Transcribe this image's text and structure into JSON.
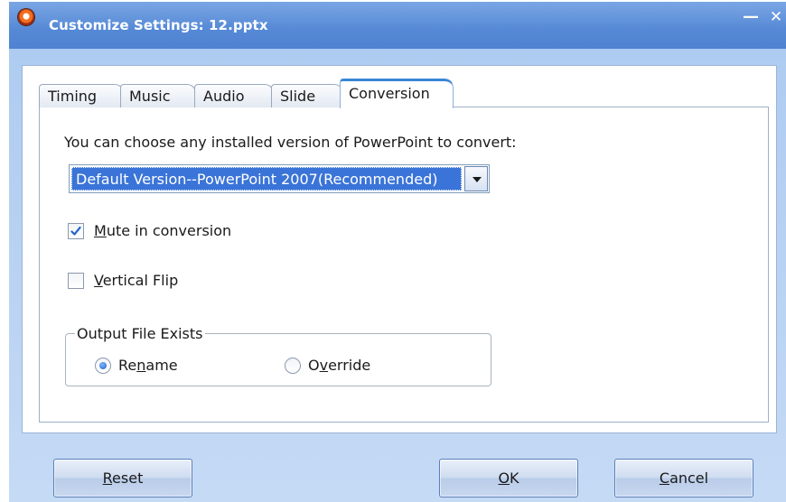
{
  "window": {
    "title": "Customize Settings: 12.pptx",
    "minimize_glyph": "—",
    "close_glyph": "✕"
  },
  "tabs": [
    {
      "label": "Timing",
      "active": false
    },
    {
      "label": "Music",
      "active": false
    },
    {
      "label": "Audio",
      "active": false
    },
    {
      "label": "Slide",
      "active": false
    },
    {
      "label": "Conversion",
      "active": true
    }
  ],
  "conversion": {
    "version_prompt": "You can choose any installed version of PowerPoint to convert:",
    "version_selected": "Default Version--PowerPoint 2007(Recommended)",
    "mute": {
      "label_before": "",
      "label_key": "M",
      "label_after": "ute in conversion",
      "checked": true
    },
    "vertical_flip": {
      "label_before": "",
      "label_key": "V",
      "label_after": "ertical Flip",
      "checked": false
    },
    "output_group": {
      "legend": "Output File Exists",
      "rename": {
        "label_before": "Re",
        "label_key": "n",
        "label_after": "ame",
        "selected": true
      },
      "override": {
        "label_before": "O",
        "label_key": "v",
        "label_after": "erride",
        "selected": false
      }
    }
  },
  "buttons": {
    "reset": {
      "label_before": "",
      "label_key": "R",
      "label_after": "eset"
    },
    "ok": {
      "label_before": "",
      "label_key": "O",
      "label_after": "K"
    },
    "cancel": {
      "label_before": "",
      "label_key": "C",
      "label_after": "ancel"
    }
  },
  "colors": {
    "title_bar": "#5589d6",
    "selection": "#3a74d8",
    "check_mark": "#1f63c9"
  },
  "icons": {
    "app": "app-logo-icon",
    "dropdown": "chevron-down-icon",
    "check": "checkmark-icon"
  }
}
